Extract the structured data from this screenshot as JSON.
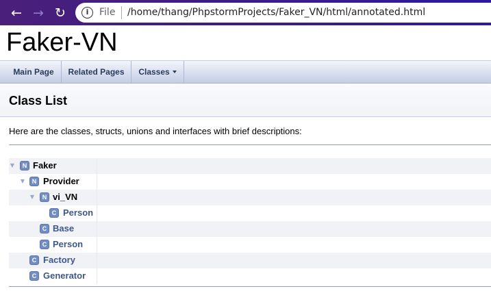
{
  "browser": {
    "back_icon": "←",
    "forward_icon": "→",
    "reload_icon": "↻",
    "info_icon": "i",
    "url_scheme_label": "File",
    "url_path": "/home/thang/PhpstormProjects/Faker_VN/html/annotated.html"
  },
  "project": {
    "title": "Faker-VN"
  },
  "navbar": {
    "items": [
      {
        "label": "Main Page"
      },
      {
        "label": "Related Pages"
      },
      {
        "label": "Classes"
      }
    ]
  },
  "page": {
    "title": "Class List",
    "intro": "Here are the classes, structs, unions and interfaces with brief descriptions:"
  },
  "tree": {
    "rows": [
      {
        "kind": "N",
        "label": "Faker",
        "expanded": true
      },
      {
        "kind": "N",
        "label": "Provider",
        "expanded": true
      },
      {
        "kind": "N",
        "label": "vi_VN",
        "expanded": true
      },
      {
        "kind": "C",
        "label": "Person"
      },
      {
        "kind": "C",
        "label": "Base"
      },
      {
        "kind": "C",
        "label": "Person"
      },
      {
        "kind": "C",
        "label": "Factory"
      },
      {
        "kind": "C",
        "label": "Generator"
      }
    ],
    "expanded_arrow": "▼"
  },
  "colors": {
    "browser_bar": "#3b1c8c",
    "navbar_text": "#283a5d",
    "class_link": "#3d578c",
    "badge": "#728dc1"
  }
}
